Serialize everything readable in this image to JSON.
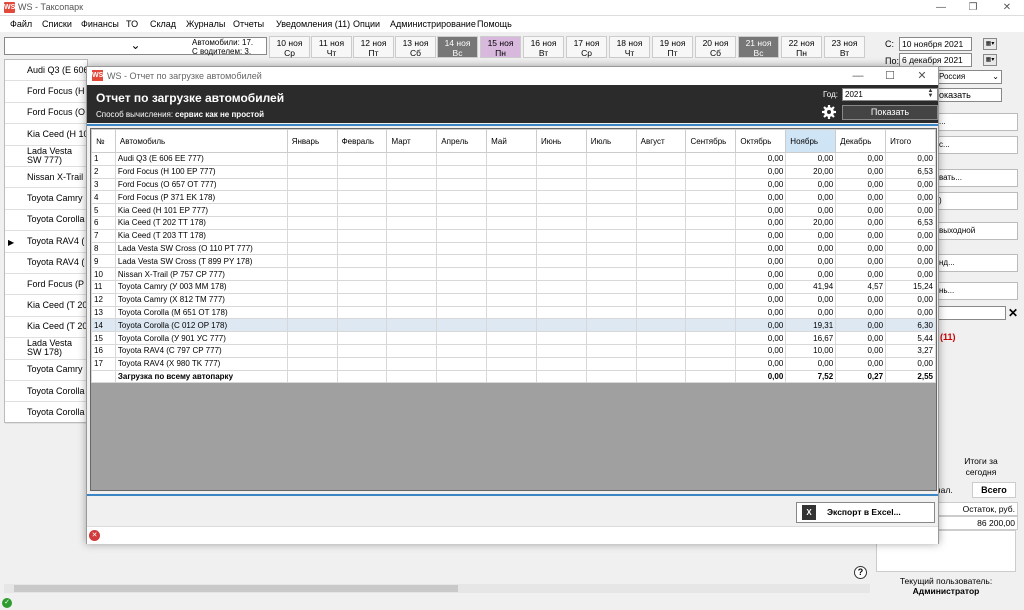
{
  "app": {
    "title": "WS - Таксопарк",
    "icon": "WS"
  },
  "menu": [
    "Файл",
    "Списки",
    "Финансы",
    "ТО",
    "Склад",
    "Журналы",
    "Отчеты",
    "Уведомления (11)",
    "Опции",
    "Администрирование",
    "Помощь"
  ],
  "toolbar": {
    "cars_count": "Автомобили: 17.",
    "with_driver": "С водителем: 3."
  },
  "dates": [
    {
      "d": "10 ноя",
      "w": "Ср"
    },
    {
      "d": "11 ноя",
      "w": "Чт"
    },
    {
      "d": "12 ноя",
      "w": "Пт"
    },
    {
      "d": "13 ноя",
      "w": "Сб"
    },
    {
      "d": "14 ноя",
      "w": "Вс"
    },
    {
      "d": "15 ноя",
      "w": "Пн"
    },
    {
      "d": "16 ноя",
      "w": "Вт"
    },
    {
      "d": "17 ноя",
      "w": "Ср"
    },
    {
      "d": "18 ноя",
      "w": "Чт"
    },
    {
      "d": "19 ноя",
      "w": "Пт"
    },
    {
      "d": "20 ноя",
      "w": "Сб"
    },
    {
      "d": "21 ноя",
      "w": "Вс"
    },
    {
      "d": "22 ноя",
      "w": "Пн"
    },
    {
      "d": "23 ноя",
      "w": "Вт"
    }
  ],
  "left_list": [
    "Audi Q3 (E 606",
    "Ford Focus (H",
    "Ford Focus (O",
    "Kia Ceed (H 10",
    "Lada Vesta SW 777)",
    "Nissan X-Trail",
    "Toyota Camry",
    "Toyota Corolla",
    "Toyota RAV4 (",
    "Toyota RAV4 (",
    "Ford Focus (P",
    "Kia Ceed (T 20",
    "Kia Ceed (T 20",
    "Lada Vesta SW 178)",
    "Toyota Camry",
    "Toyota Corolla",
    "Toyota Corolla"
  ],
  "right_panel": {
    "from_label": "С:",
    "from_date": "10 ноября 2021",
    "to_label": "По:",
    "to_date": "6 декабря 2021",
    "country": "Россия",
    "show": "оказать",
    "buttons": [
      "...",
      "с...",
      "вать...",
      ")",
      "выходной",
      "нд...",
      "нь..."
    ],
    "notifications": "(11)",
    "totals_day": "Итоги за сегодня",
    "tab_received": "знал.",
    "tab_total": "Всего",
    "balance_label": "Остаток, руб.",
    "balance_value": "86 200,00",
    "current_user_label": "Текущий пользователь:",
    "current_user": "Администратор"
  },
  "dialog": {
    "title": "WS - Отчет по загрузке автомобилей",
    "heading": "Отчет по загрузке автомобилей",
    "calc_label": "Способ вычисления:",
    "calc_value": "сервис как не простой",
    "year_label": "Год:",
    "year_value": "2021",
    "show_button": "Показать",
    "export_button": "Экспорт в Excel...",
    "columns": [
      "№",
      "Автомобиль",
      "Январь",
      "Февраль",
      "Март",
      "Апрель",
      "Май",
      "Июнь",
      "Июль",
      "Август",
      "Сентябрь",
      "Октябрь",
      "Ноябрь",
      "Декабрь",
      "Итого"
    ],
    "rows": [
      [
        "1",
        "Audi Q3 (E 606 EE 777)",
        "0,00",
        "0,00",
        "0,00",
        "0,00"
      ],
      [
        "2",
        "Ford Focus (H 100 EP 777)",
        "0,00",
        "20,00",
        "0,00",
        "6,53"
      ],
      [
        "3",
        "Ford Focus (O 657 OT 777)",
        "0,00",
        "0,00",
        "0,00",
        "0,00"
      ],
      [
        "4",
        "Ford Focus (P 371 EK 178)",
        "0,00",
        "0,00",
        "0,00",
        "0,00"
      ],
      [
        "5",
        "Kia Ceed (H 101 EP 777)",
        "0,00",
        "0,00",
        "0,00",
        "0,00"
      ],
      [
        "6",
        "Kia Ceed (T 202 TT 178)",
        "0,00",
        "20,00",
        "0,00",
        "6,53"
      ],
      [
        "7",
        "Kia Ceed (T 203 TT 178)",
        "0,00",
        "0,00",
        "0,00",
        "0,00"
      ],
      [
        "8",
        "Lada Vesta SW Cross (O 110 PT 777)",
        "0,00",
        "0,00",
        "0,00",
        "0,00"
      ],
      [
        "9",
        "Lada Vesta SW Cross (T 899 PY 178)",
        "0,00",
        "0,00",
        "0,00",
        "0,00"
      ],
      [
        "10",
        "Nissan X-Trail (P 757 CP 777)",
        "0,00",
        "0,00",
        "0,00",
        "0,00"
      ],
      [
        "11",
        "Toyota Camry (У 003 MM 178)",
        "0,00",
        "41,94",
        "4,57",
        "15,24"
      ],
      [
        "12",
        "Toyota Camry (X 812 TM 777)",
        "0,00",
        "0,00",
        "0,00",
        "0,00"
      ],
      [
        "13",
        "Toyota Corolla (M 651 OT 178)",
        "0,00",
        "0,00",
        "0,00",
        "0,00"
      ],
      [
        "14",
        "Toyota Corolla (C 012 OP 178)",
        "0,00",
        "19,31",
        "0,00",
        "6,30"
      ],
      [
        "15",
        "Toyota Corolla (У 901 УС 777)",
        "0,00",
        "16,67",
        "0,00",
        "5,44"
      ],
      [
        "16",
        "Toyota RAV4 (C 797 CP 777)",
        "0,00",
        "10,00",
        "0,00",
        "3,27"
      ],
      [
        "17",
        "Toyota RAV4 (X 980 TK 777)",
        "0,00",
        "0,00",
        "0,00",
        "0,00"
      ]
    ],
    "total_row": [
      "",
      "Загрузка по всему автопарку",
      "0,00",
      "7,52",
      "0,27",
      "2,55"
    ],
    "selected_row": 14,
    "highlight_column": "Ноябрь"
  },
  "colors": {
    "header_dark": "#2b2b2b",
    "accent_blue": "#3d86c6",
    "selected_date": "#777777",
    "today_pink": "#d9b8de",
    "error_red": "#d03a3a"
  }
}
